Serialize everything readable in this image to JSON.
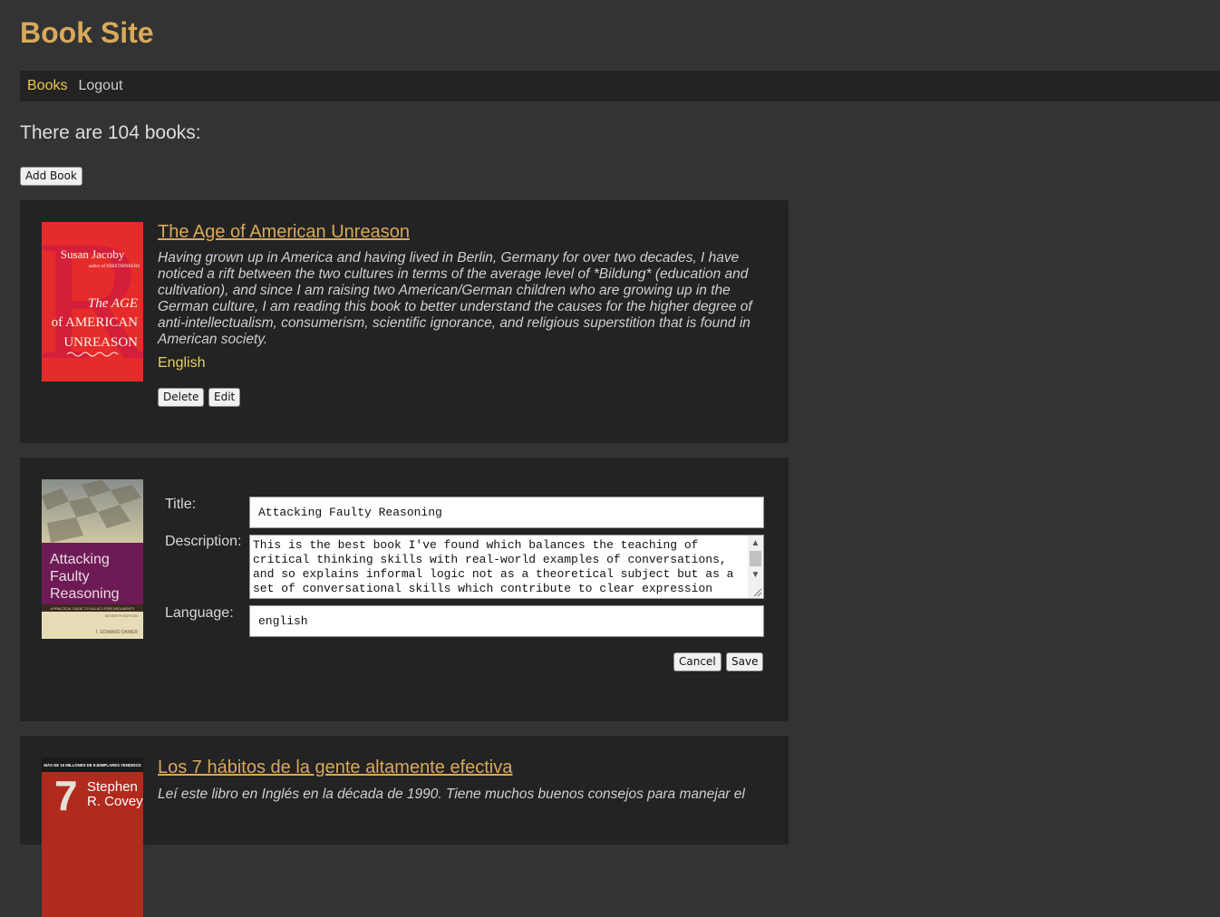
{
  "site": {
    "title": "Book Site"
  },
  "nav": {
    "books": "Books",
    "logout": "Logout"
  },
  "summary": {
    "count_text": "There are 104 books:"
  },
  "actions": {
    "add_book": "Add Book"
  },
  "books": [
    {
      "title": "The Age of American Unreason",
      "description": "Having grown up in America and having lived in Berlin, Germany for over two decades, I have noticed a rift between the two cultures in terms of the average level of *Bildung* (education and cultivation), and since I am raising two American/German children who are growing up in the German culture, I am reading this book to better understand the causes for the higher degree of anti-intellectualism, consumerism, scientific ignorance, and religious superstition that is found in American society.",
      "language": "English",
      "delete_label": "Delete",
      "edit_label": "Edit",
      "cover": {
        "author": "Susan Jacoby",
        "tagline": "author of FREETHINKERS",
        "line1": "The AGE",
        "line2": "of AMERICAN",
        "line3": "UNREASON"
      }
    },
    {
      "editing": true,
      "form": {
        "title_label": "Title:",
        "description_label": "Description:",
        "language_label": "Language:",
        "title_value": "Attacking Faulty Reasoning",
        "description_value": "This is the best book I've found which balances the teaching of critical thinking skills with real-world examples of conversations, and so explains informal logic not as a theoretical subject but as a set of conversational skills which contribute to clear expression",
        "language_value": "english",
        "cancel_label": "Cancel",
        "save_label": "Save"
      },
      "cover": {
        "line1": "Attacking",
        "line2": "Faulty",
        "line3": "Reasoning",
        "subtitle": "A PRACTICAL GUIDE TO FALLACY-FREE ARGUMENTS",
        "edition": "SEVENTH EDITION",
        "author": "T. EDWARD DAMER"
      }
    },
    {
      "title": "Los 7 hábitos de la gente altamente efectiva",
      "description": "Leí este libro en Inglés en la década de 1990. Tiene muchos buenos consejos para manejar el",
      "cover": {
        "banner": "MÁS DE 15 MILLONES DE EJEMPLARES VENDIDOS",
        "number": "7",
        "author_line1": "Stephen",
        "author_line2": "R. Covey"
      }
    }
  ],
  "colors": {
    "background": "#333333",
    "card": "#232323",
    "accent": "#d9a85a",
    "language": "#e6cf6a"
  }
}
